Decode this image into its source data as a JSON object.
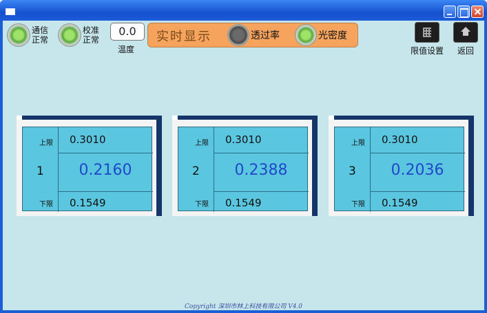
{
  "window": {
    "title": ""
  },
  "status": {
    "comm": {
      "label": "通信正常",
      "line1": "通信",
      "line2": "正常",
      "state": "ok"
    },
    "calib": {
      "label": "校准正常",
      "line1": "校准",
      "line2": "正常",
      "state": "ok"
    },
    "temperature": {
      "value": "0.0",
      "label": "温度"
    }
  },
  "mode": {
    "title": "实时显示",
    "options": [
      {
        "label": "透过率",
        "selected": false
      },
      {
        "label": "光密度",
        "selected": true
      }
    ]
  },
  "toolbar": {
    "limit_settings_label": "限值设置",
    "back_label": "返回"
  },
  "channels": [
    {
      "num": "1",
      "upper_label": "上限",
      "lower_label": "下限",
      "upper": "0.3010",
      "value": "0.2160",
      "lower": "0.1549"
    },
    {
      "num": "2",
      "upper_label": "上限",
      "lower_label": "下限",
      "upper": "0.3010",
      "value": "0.2388",
      "lower": "0.1549"
    },
    {
      "num": "3",
      "upper_label": "上限",
      "lower_label": "下限",
      "upper": "0.3010",
      "value": "0.2036",
      "lower": "0.1549"
    }
  ],
  "footer": {
    "copyright": "Copyright 深圳市林上科技有限公司 V4.0"
  },
  "colors": {
    "title_bar": "#1b5fd6",
    "client_bg": "#c7e6ec",
    "panel_bg": "#5bc6df",
    "value_text": "#1f49c9",
    "mode_panel": "#f6a45d"
  },
  "icons": {
    "comm": "green-led-icon",
    "calib": "green-led-icon",
    "transmittance": "gray-led-icon",
    "density": "green-led-icon",
    "limit_settings": "grid-icon",
    "back": "home-icon"
  }
}
